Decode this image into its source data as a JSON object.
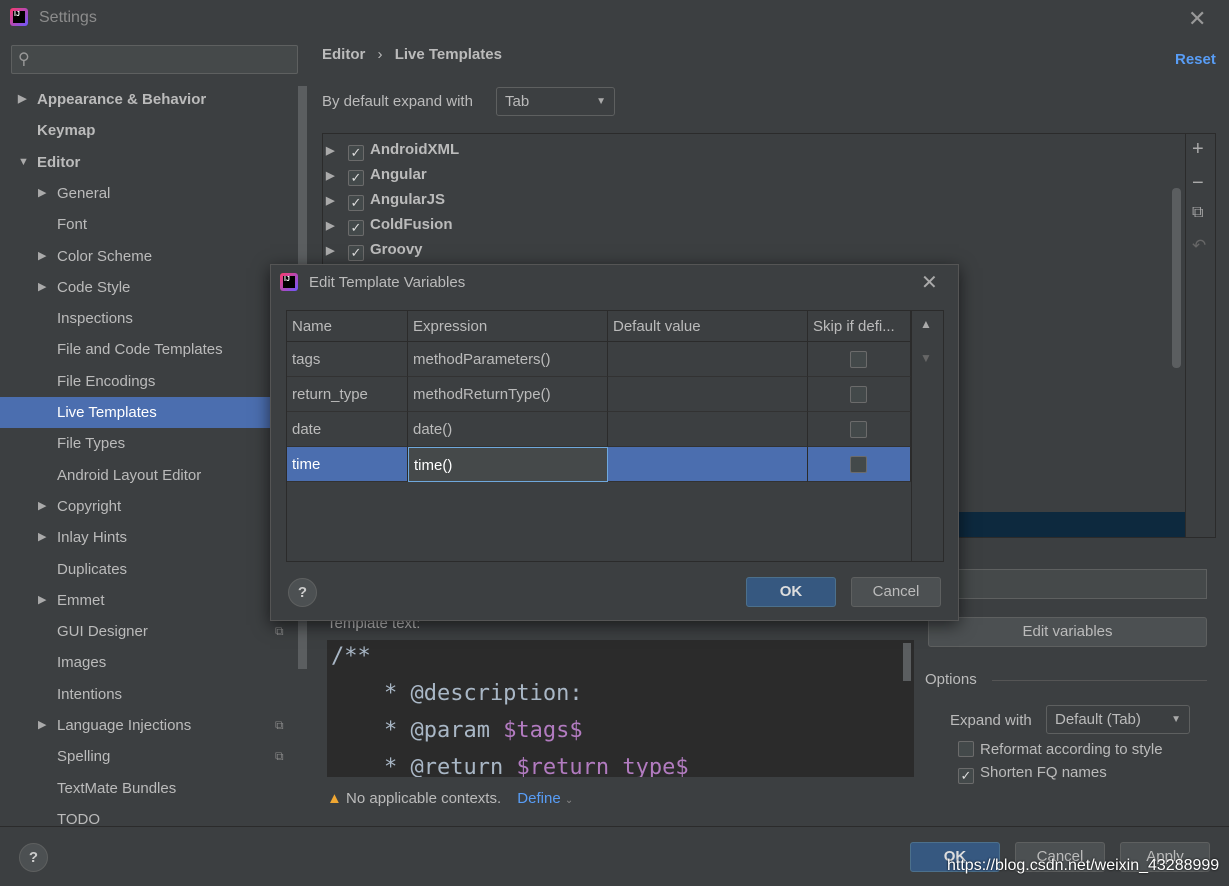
{
  "window": {
    "title": "Settings",
    "close_icon": "close-icon"
  },
  "sidebar": {
    "search_placeholder": "",
    "items": [
      {
        "label": "Appearance & Behavior",
        "level": 0,
        "expandable": true,
        "expanded": false
      },
      {
        "label": "Keymap",
        "level": 0
      },
      {
        "label": "Editor",
        "level": 0,
        "expandable": true,
        "expanded": true
      },
      {
        "label": "General",
        "level": 1,
        "expandable": true
      },
      {
        "label": "Font",
        "level": 1
      },
      {
        "label": "Color Scheme",
        "level": 1,
        "expandable": true
      },
      {
        "label": "Code Style",
        "level": 1,
        "expandable": true
      },
      {
        "label": "Inspections",
        "level": 1
      },
      {
        "label": "File and Code Templates",
        "level": 1
      },
      {
        "label": "File Encodings",
        "level": 1
      },
      {
        "label": "Live Templates",
        "level": 1,
        "selected": true
      },
      {
        "label": "File Types",
        "level": 1
      },
      {
        "label": "Android Layout Editor",
        "level": 1
      },
      {
        "label": "Copyright",
        "level": 1,
        "expandable": true
      },
      {
        "label": "Inlay Hints",
        "level": 1,
        "expandable": true
      },
      {
        "label": "Duplicates",
        "level": 1
      },
      {
        "label": "Emmet",
        "level": 1,
        "expandable": true
      },
      {
        "label": "GUI Designer",
        "level": 1,
        "project": true
      },
      {
        "label": "Images",
        "level": 1
      },
      {
        "label": "Intentions",
        "level": 1
      },
      {
        "label": "Language Injections",
        "level": 1,
        "expandable": true,
        "project": true
      },
      {
        "label": "Spelling",
        "level": 1,
        "project": true
      },
      {
        "label": "TextMate Bundles",
        "level": 1
      },
      {
        "label": "TODO",
        "level": 1
      }
    ]
  },
  "main": {
    "breadcrumb": [
      "Editor",
      "Live Templates"
    ],
    "breadcrumb_sep": "›",
    "reset": "Reset",
    "expand_label": "By default expand with",
    "expand_value": "Tab",
    "groups": [
      {
        "label": "AndroidXML",
        "checked": true
      },
      {
        "label": "Angular",
        "checked": true
      },
      {
        "label": "AngularJS",
        "checked": true
      },
      {
        "label": "ColdFusion",
        "checked": true
      },
      {
        "label": "Groovy",
        "checked": true
      }
    ],
    "template_text_label": "Template text:",
    "template_lines": [
      {
        "text": "/**"
      },
      {
        "text": "    * @description:"
      },
      {
        "text": "    * @param ",
        "var": "$tags$"
      },
      {
        "text": "    * @return ",
        "var": "$return_type$"
      }
    ],
    "edit_variables": "Edit variables",
    "options_label": "Options",
    "expand_with_label": "Expand with",
    "expand_with_value": "Default (Tab)",
    "reformat_label": "Reformat according to style",
    "reformat_checked": false,
    "shorten_label": "Shorten FQ names",
    "shorten_checked": true,
    "warning": "No applicable contexts.",
    "define": "Define"
  },
  "dialog": {
    "title": "Edit Template Variables",
    "columns": [
      "Name",
      "Expression",
      "Default value",
      "Skip if defi..."
    ],
    "rows": [
      {
        "name": "tags",
        "expression": "methodParameters()",
        "default": "",
        "skip": false
      },
      {
        "name": "return_type",
        "expression": "methodReturnType()",
        "default": "",
        "skip": false
      },
      {
        "name": "date",
        "expression": "date()",
        "default": "",
        "skip": false
      },
      {
        "name": "time",
        "expression": "time()",
        "default": "",
        "skip": false,
        "selected": true
      }
    ],
    "ok": "OK",
    "cancel": "Cancel",
    "help": "?"
  },
  "footer": {
    "ok": "OK",
    "cancel": "Cancel",
    "apply": "Apply",
    "help": "?"
  },
  "watermark": "https://blog.csdn.net/weixin_43288999",
  "colors": {
    "selection": "#4b6eaf",
    "link": "#589df6",
    "variable": "#b27bc0",
    "default_button": "#365880"
  }
}
